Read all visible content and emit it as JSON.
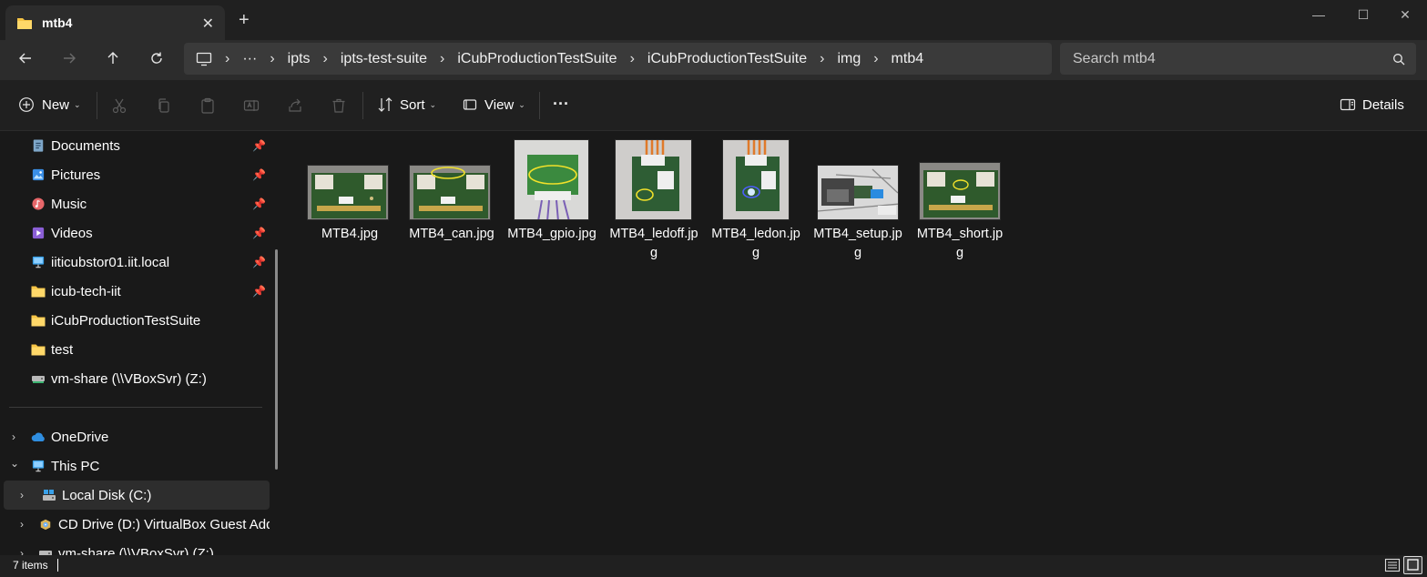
{
  "window": {
    "tab_title": "mtb4",
    "new_tab": "+",
    "minimize": "—",
    "maximize": "☐",
    "close": "✕",
    "accent": "#4cc2ff"
  },
  "address": {
    "ellipsis": "···",
    "crumbs": [
      "ipts",
      "ipts-test-suite",
      "iCubProductionTestSuite",
      "iCubProductionTestSuite",
      "img",
      "mtb4"
    ],
    "separator": "›"
  },
  "search": {
    "placeholder": "Search mtb4"
  },
  "toolbar": {
    "new_label": "New",
    "sort_label": "Sort",
    "view_label": "View",
    "more_label": "···",
    "details_label": "Details"
  },
  "sidebar": {
    "quick_access": [
      {
        "label": "Documents",
        "icon": "documents-icon",
        "pinned": true
      },
      {
        "label": "Pictures",
        "icon": "pictures-icon",
        "pinned": true
      },
      {
        "label": "Music",
        "icon": "music-icon",
        "pinned": true
      },
      {
        "label": "Videos",
        "icon": "videos-icon",
        "pinned": true
      },
      {
        "label": "iiticubstor01.iit.local",
        "icon": "network-drive-icon",
        "pinned": true
      },
      {
        "label": "icub-tech-iit",
        "icon": "folder-icon",
        "pinned": true
      },
      {
        "label": "iCubProductionTestSuite",
        "icon": "folder-icon",
        "pinned": false
      },
      {
        "label": "test",
        "icon": "folder-icon",
        "pinned": false
      },
      {
        "label": "vm-share (\\\\VBoxSvr) (Z:)",
        "icon": "network-share-icon",
        "pinned": false
      }
    ],
    "tree": [
      {
        "label": "OneDrive",
        "icon": "cloud-icon",
        "expanded": false
      },
      {
        "label": "This PC",
        "icon": "pc-icon",
        "expanded": true
      },
      {
        "label": "Local Disk (C:)",
        "icon": "disk-icon",
        "expanded": false,
        "selected": true
      },
      {
        "label": "CD Drive (D:) VirtualBox Guest Add",
        "icon": "cd-drive-icon",
        "expanded": false
      },
      {
        "label": "vm-share (\\\\VBoxSvr) (Z:)",
        "icon": "network-share-icon",
        "expanded": false
      }
    ]
  },
  "files": [
    {
      "name": "MTB4.jpg",
      "kind": "board"
    },
    {
      "name": "MTB4_can.jpg",
      "kind": "board-can"
    },
    {
      "name": "MTB4_gpio.jpg",
      "kind": "gpio"
    },
    {
      "name": "MTB4_ledoff.jpg",
      "kind": "ledoff"
    },
    {
      "name": "MTB4_ledon.jpg",
      "kind": "ledon"
    },
    {
      "name": "MTB4_setup.jpg",
      "kind": "setup"
    },
    {
      "name": "MTB4_short.jpg",
      "kind": "board-short"
    }
  ],
  "status": {
    "count": "7 items"
  }
}
